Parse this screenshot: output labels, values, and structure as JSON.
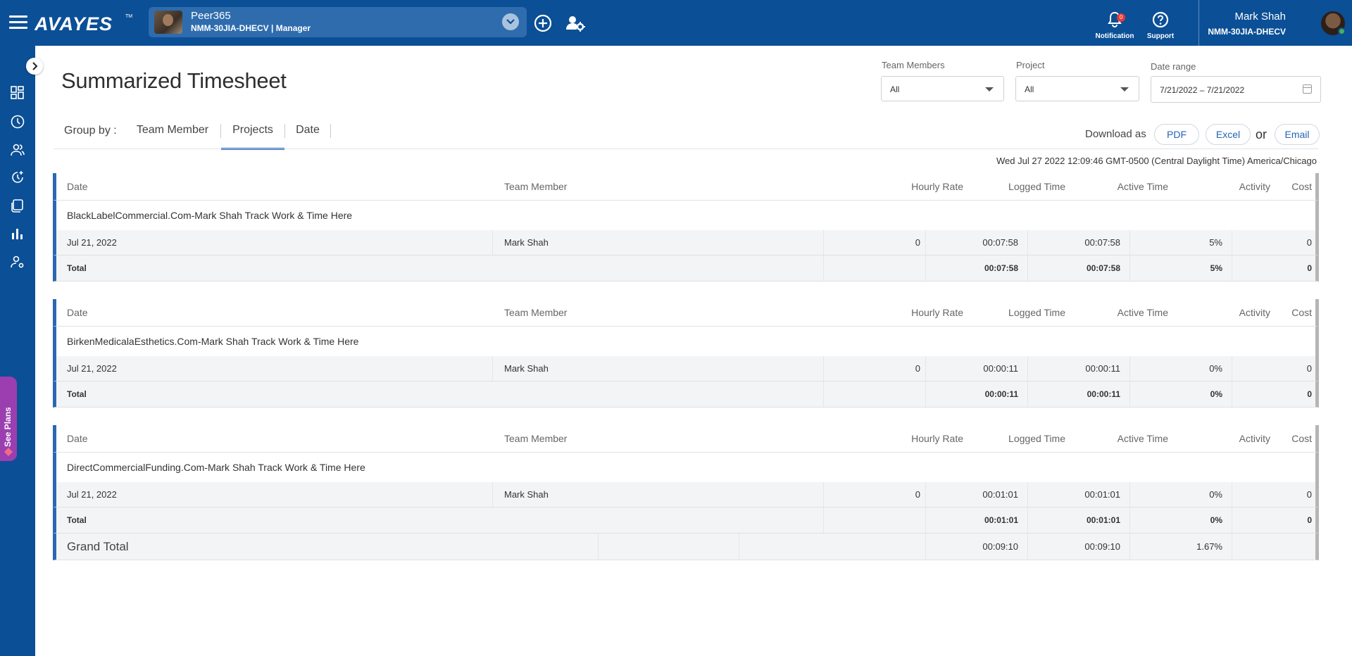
{
  "app": {
    "logo_text": "AVAYES",
    "logo_tm": "TM",
    "workspace": {
      "name": "Peer365",
      "subtitle": "NMM-30JIA-DHECV | Manager"
    },
    "notification": {
      "label": "Notification",
      "count": "0"
    },
    "support": {
      "label": "Support"
    },
    "user": {
      "name": "Mark Shah",
      "workspace_id": "NMM-30JIA-DHECV"
    },
    "see_plans": "See Plans"
  },
  "page": {
    "title": "Summarized Timesheet",
    "filters": {
      "team_members": {
        "label": "Team Members",
        "value": "All"
      },
      "project": {
        "label": "Project",
        "value": "All"
      },
      "date_range": {
        "label": "Date range",
        "value": "7/21/2022 – 7/21/2022"
      }
    },
    "group_by": {
      "label": "Group by :",
      "tabs": [
        "Team Member",
        "Projects",
        "Date"
      ],
      "active": "Projects"
    },
    "download": {
      "label": "Download as",
      "pdf": "PDF",
      "excel": "Excel",
      "or": "or",
      "email": "Email"
    },
    "timestamp": "Wed Jul 27 2022 12:09:46 GMT-0500 (Central Daylight Time)  America/Chicago"
  },
  "table": {
    "columns": [
      "Date",
      "Team Member",
      "Hourly Rate",
      "Logged Time",
      "Active Time",
      "Activity",
      "Cost"
    ],
    "groups": [
      {
        "project": "BlackLabelCommercial.Com-Mark Shah Track Work & Time Here",
        "rows": [
          {
            "date": "Jul 21, 2022",
            "member": "Mark Shah",
            "rate": "0",
            "logged": "00:07:58",
            "active": "00:07:58",
            "activity": "5%",
            "cost": "0"
          }
        ],
        "total": {
          "label": "Total",
          "logged": "00:07:58",
          "active": "00:07:58",
          "activity": "5%",
          "cost": "0"
        }
      },
      {
        "project": "BirkenMedicalaEsthetics.Com-Mark Shah Track Work & Time Here",
        "rows": [
          {
            "date": "Jul 21, 2022",
            "member": "Mark Shah",
            "rate": "0",
            "logged": "00:00:11",
            "active": "00:00:11",
            "activity": "0%",
            "cost": "0"
          }
        ],
        "total": {
          "label": "Total",
          "logged": "00:00:11",
          "active": "00:00:11",
          "activity": "0%",
          "cost": "0"
        }
      },
      {
        "project": "DirectCommercialFunding.Com-Mark Shah Track Work & Time Here",
        "rows": [
          {
            "date": "Jul 21, 2022",
            "member": "Mark Shah",
            "rate": "0",
            "logged": "00:01:01",
            "active": "00:01:01",
            "activity": "0%",
            "cost": "0"
          }
        ],
        "total": {
          "label": "Total",
          "logged": "00:01:01",
          "active": "00:01:01",
          "activity": "0%",
          "cost": "0"
        }
      }
    ],
    "grand_total": {
      "label": "Grand Total",
      "logged": "00:09:10",
      "active": "00:09:10",
      "activity": "1.67%"
    }
  },
  "colors": {
    "brand": "#0b4f96",
    "accent": "#1d66c0",
    "row_bg": "#f3f4f6",
    "see_plans": "#9b3fb0"
  },
  "icons": [
    "menu-icon",
    "chevron-down-icon",
    "add-circle-icon",
    "user-settings-icon",
    "bell-icon",
    "help-icon",
    "chevron-right-icon",
    "dashboard-icon",
    "clock-icon",
    "team-icon",
    "timer-icon",
    "projects-icon",
    "reports-icon",
    "user-manage-icon",
    "calendar-icon"
  ]
}
